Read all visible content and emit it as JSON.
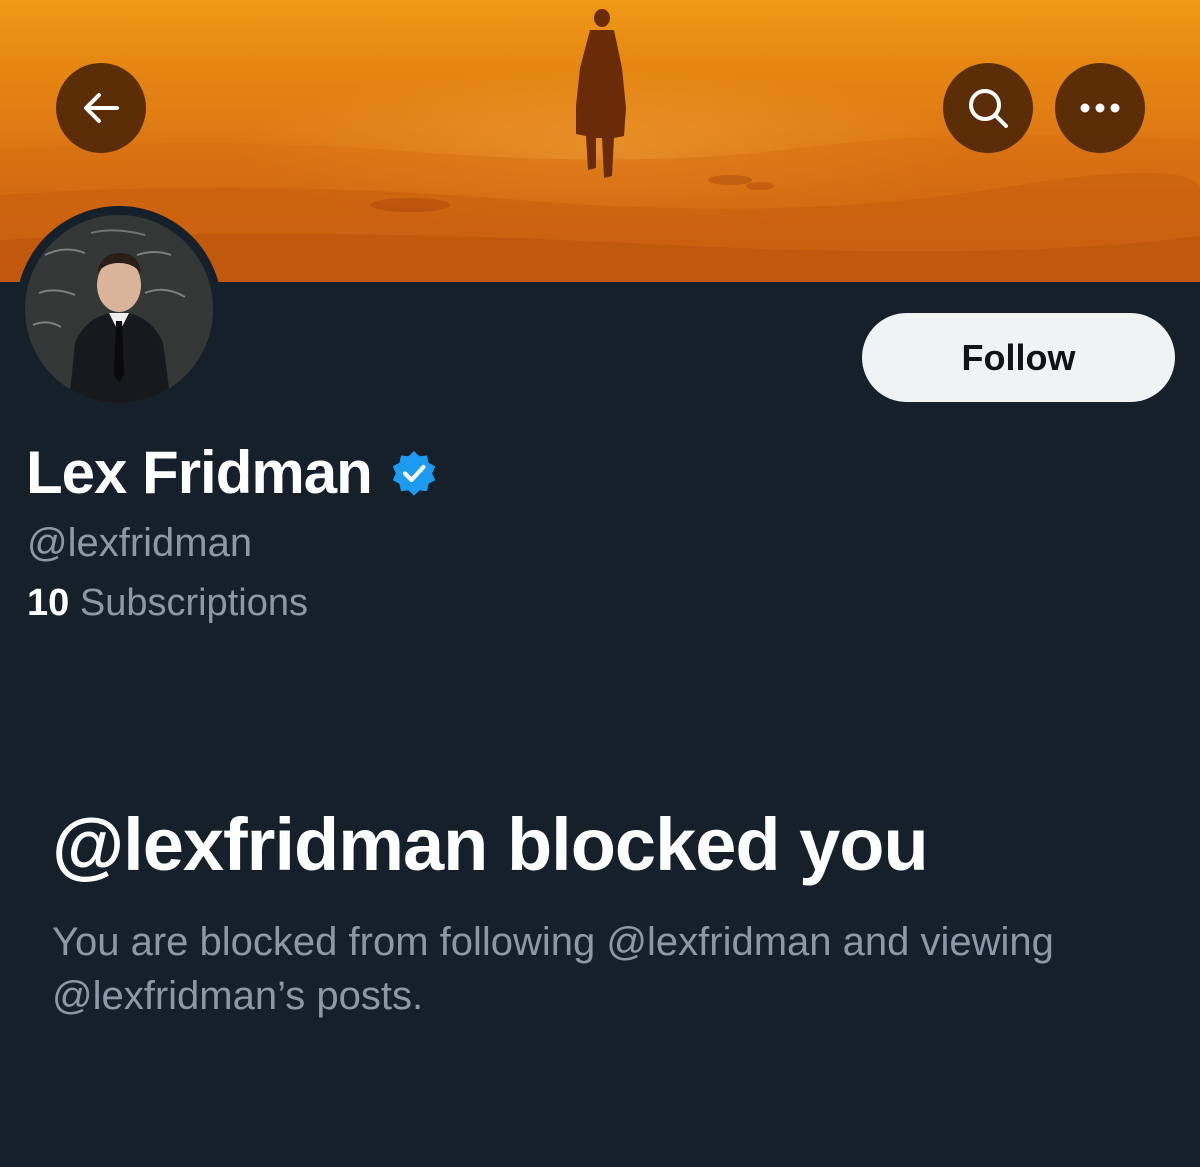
{
  "header": {
    "back_icon": "arrow-left-icon",
    "search_icon": "search-icon",
    "more_icon": "more-horizontal-icon"
  },
  "profile": {
    "display_name": "Lex Fridman",
    "verified_icon": "verified-badge-icon",
    "verified_color": "#1d9bf0",
    "handle": "@lexfridman",
    "subscriptions_count": "10",
    "subscriptions_label": "Subscriptions",
    "follow_label": "Follow"
  },
  "blocked": {
    "title": "@lexfridman blocked you",
    "message": "You are blocked from following @lexfridman and viewing @lexfridman’s posts."
  },
  "colors": {
    "background": "#15202b",
    "secondary_text": "#8b98a5",
    "follow_button_bg": "#eff3f4",
    "banner_orange": "#e5801a"
  }
}
